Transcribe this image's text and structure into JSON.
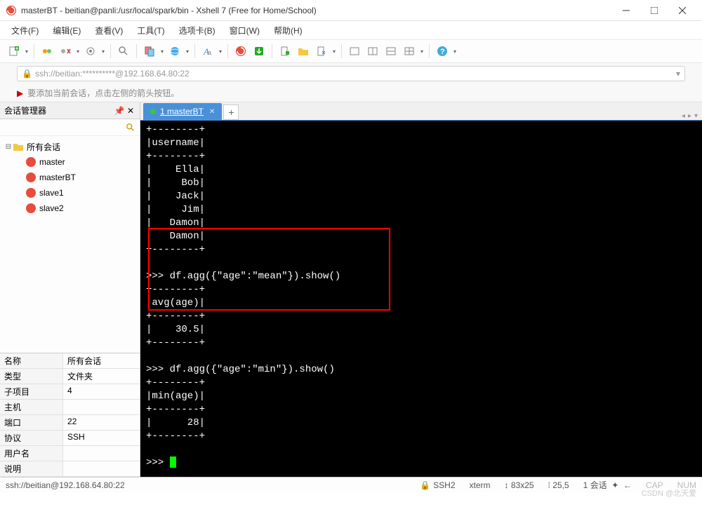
{
  "window": {
    "title": "masterBT - beitian@panli:/usr/local/spark/bin - Xshell 7 (Free for Home/School)"
  },
  "menu": {
    "file": "文件(F)",
    "edit": "编辑(E)",
    "view": "查看(V)",
    "tools": "工具(T)",
    "tabs": "选项卡(B)",
    "window": "窗口(W)",
    "help": "帮助(H)"
  },
  "address": {
    "url": "ssh://beitian:**********@192.168.64.80:22"
  },
  "hint": {
    "text": "要添加当前会话，点击左侧的箭头按钮。"
  },
  "sidebar": {
    "title": "会话管理器",
    "root": "所有会话",
    "items": [
      "master",
      "masterBT",
      "slave1",
      "slave2"
    ]
  },
  "props": {
    "rows": [
      {
        "k": "名称",
        "v": "所有会话"
      },
      {
        "k": "类型",
        "v": "文件夹"
      },
      {
        "k": "子项目",
        "v": "4"
      },
      {
        "k": "主机",
        "v": ""
      },
      {
        "k": "端口",
        "v": "22"
      },
      {
        "k": "协议",
        "v": "SSH"
      },
      {
        "k": "用户名",
        "v": ""
      },
      {
        "k": "说明",
        "v": ""
      }
    ]
  },
  "tab": {
    "label": "1 masterBT"
  },
  "terminal": {
    "lines": [
      "+--------+",
      "|username|",
      "+--------+",
      "|    Ella|",
      "|     Bob|",
      "|    Jack|",
      "|     Jim|",
      "|   Damon|",
      "|   Damon|",
      "+--------+",
      "",
      ">>> df.agg({\"age\":\"mean\"}).show()",
      "+--------+",
      "|avg(age)|",
      "+--------+",
      "|    30.5|",
      "+--------+",
      "",
      ">>> df.agg({\"age\":\"min\"}).show()",
      "+--------+",
      "|min(age)|",
      "+--------+",
      "|      28|",
      "+--------+",
      "",
      ">>> "
    ]
  },
  "status": {
    "conn": "ssh://beitian@192.168.64.80:22",
    "proto": "SSH2",
    "term": "xterm",
    "size": "83x25",
    "pos": "25,5",
    "sess": "1 会话",
    "cap": "CAP",
    "num": "NUM"
  },
  "watermark": "CSDN @北天爱"
}
